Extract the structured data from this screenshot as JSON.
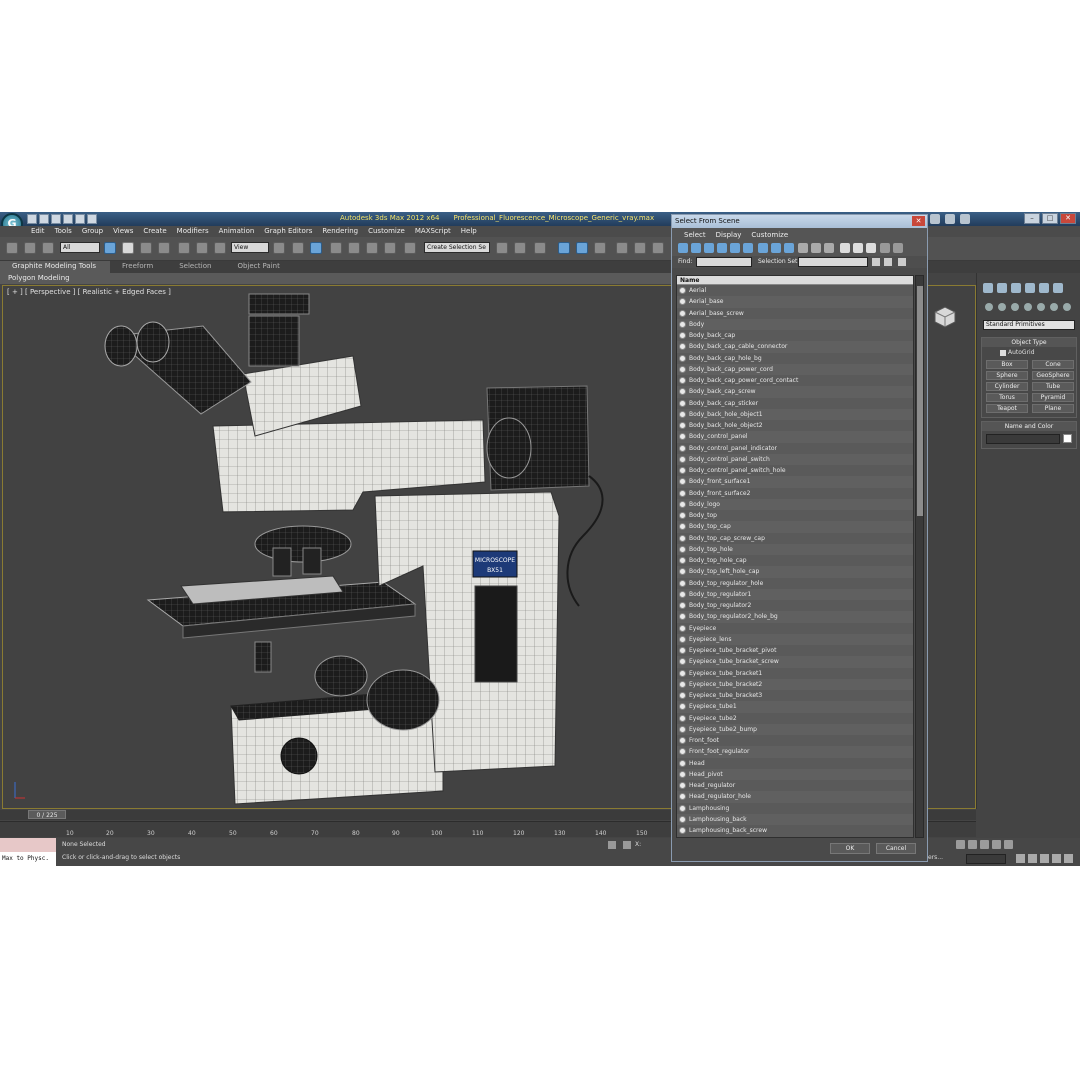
{
  "window": {
    "title": "Autodesk 3ds Max  2012 x64",
    "file": "Professional_Fluorescence_Microscope_Generic_vray.max"
  },
  "menu": [
    "Edit",
    "Tools",
    "Group",
    "Views",
    "Create",
    "Modifiers",
    "Animation",
    "Graph Editors",
    "Rendering",
    "Customize",
    "MAXScript",
    "Help"
  ],
  "toolbar": {
    "filter_value": "All",
    "view_value": "View",
    "selection_set_placeholder": "Create Selection Se"
  },
  "ribbon": {
    "tabs": [
      "Graphite Modeling Tools",
      "Freeform",
      "Selection",
      "Object Paint"
    ],
    "subtab": "Polygon Modeling"
  },
  "viewport": {
    "label": "[ + ] [ Perspective ] [ Realistic + Edged Faces ]",
    "plate_line1": "MICROSCOPE",
    "plate_line2": "BX51"
  },
  "command_panel": {
    "category": "Standard Primitives",
    "object_type_title": "Object Type",
    "autogrid": "AutoGrid",
    "objects": [
      "Box",
      "Cone",
      "Sphere",
      "GeoSphere",
      "Cylinder",
      "Tube",
      "Torus",
      "Pyramid",
      "Teapot",
      "Plane"
    ],
    "name_color_title": "Name and Color"
  },
  "timeline": {
    "position": "0 / 225",
    "ticks": [
      "10",
      "20",
      "30",
      "40",
      "50",
      "60",
      "70",
      "80",
      "90",
      "100",
      "110",
      "120",
      "130",
      "140",
      "150"
    ]
  },
  "status": {
    "script_label": "Max to Physc.",
    "selection": "None Selected",
    "prompt": "Click or click-and-drag to select objects",
    "x_label": "X:",
    "set_keys": "ers..."
  },
  "dialog": {
    "title": "Select From Scene",
    "menu": [
      "Select",
      "Display",
      "Customize"
    ],
    "find_label": "Find:",
    "selset_label": "Selection Set:",
    "column_header": "Name",
    "items": [
      "Aerial",
      "Aerial_base",
      "Aerial_base_screw",
      "Body",
      "Body_back_cap",
      "Body_back_cap_cable_connector",
      "Body_back_cap_hole_bg",
      "Body_back_cap_power_cord",
      "Body_back_cap_power_cord_contact",
      "Body_back_cap_screw",
      "Body_back_cap_sticker",
      "Body_back_hole_object1",
      "Body_back_hole_object2",
      "Body_control_panel",
      "Body_control_panel_indicator",
      "Body_control_panel_switch",
      "Body_control_panel_switch_hole",
      "Body_front_surface1",
      "Body_front_surface2",
      "Body_logo",
      "Body_top",
      "Body_top_cap",
      "Body_top_cap_screw_cap",
      "Body_top_hole",
      "Body_top_hole_cap",
      "Body_top_left_hole_cap",
      "Body_top_regulator_hole",
      "Body_top_regulator1",
      "Body_top_regulator2",
      "Body_top_regulator2_hole_bg",
      "Eyepiece",
      "Eyepiece_lens",
      "Eyepiece_tube_bracket_pivot",
      "Eyepiece_tube_bracket_screw",
      "Eyepiece_tube_bracket1",
      "Eyepiece_tube_bracket2",
      "Eyepiece_tube_bracket3",
      "Eyepiece_tube1",
      "Eyepiece_tube2",
      "Eyepiece_tube2_bump",
      "Front_foot",
      "Front_foot_regulator",
      "Head",
      "Head_pivot",
      "Head_regulator",
      "Head_regulator_hole",
      "Lamphousing",
      "Lamphousing_back",
      "Lamphousing_back_screw"
    ],
    "ok": "OK",
    "cancel": "Cancel"
  }
}
